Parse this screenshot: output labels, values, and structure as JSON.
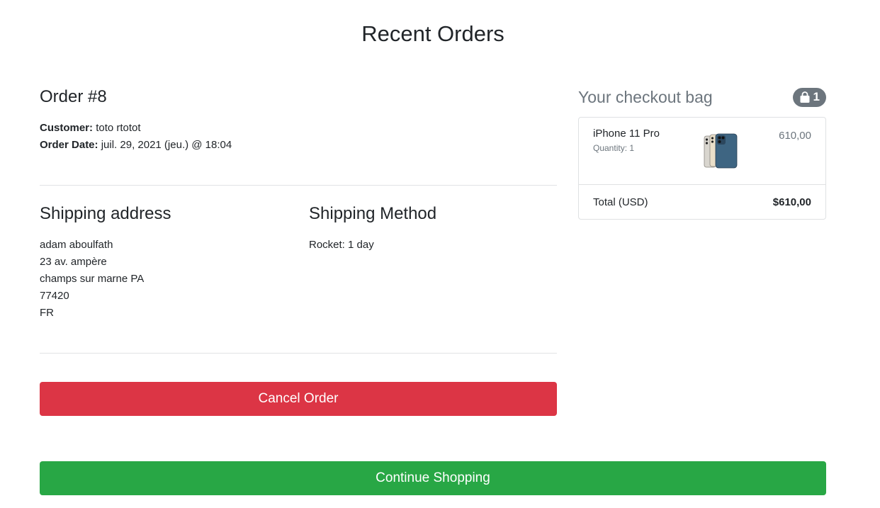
{
  "page": {
    "title": "Recent Orders"
  },
  "order": {
    "title": "Order #8",
    "customer_label": "Customer:",
    "customer_value": "toto rtotot",
    "date_label": "Order Date:",
    "date_value": "juil. 29, 2021 (jeu.) @ 18:04"
  },
  "shipping_address": {
    "title": "Shipping address",
    "lines": [
      "adam aboulfath",
      "23 av. ampère",
      "champs sur marne PA",
      "77420",
      "FR"
    ]
  },
  "shipping_method": {
    "title": "Shipping Method",
    "value": "Rocket: 1 day"
  },
  "actions": {
    "cancel_label": "Cancel Order",
    "continue_label": "Continue Shopping"
  },
  "bag": {
    "title": "Your checkout bag",
    "count": "1",
    "item": {
      "name": "iPhone 11 Pro",
      "quantity": "Quantity: 1",
      "price": "610,00"
    },
    "total_label": "Total (USD)",
    "total_value": "$610,00"
  },
  "colors": {
    "danger": "#dc3545",
    "success": "#28a745",
    "muted": "#6c757d"
  },
  "icons": {
    "bag_icon": "shopping-bag-icon",
    "product_image": "phone-image"
  }
}
